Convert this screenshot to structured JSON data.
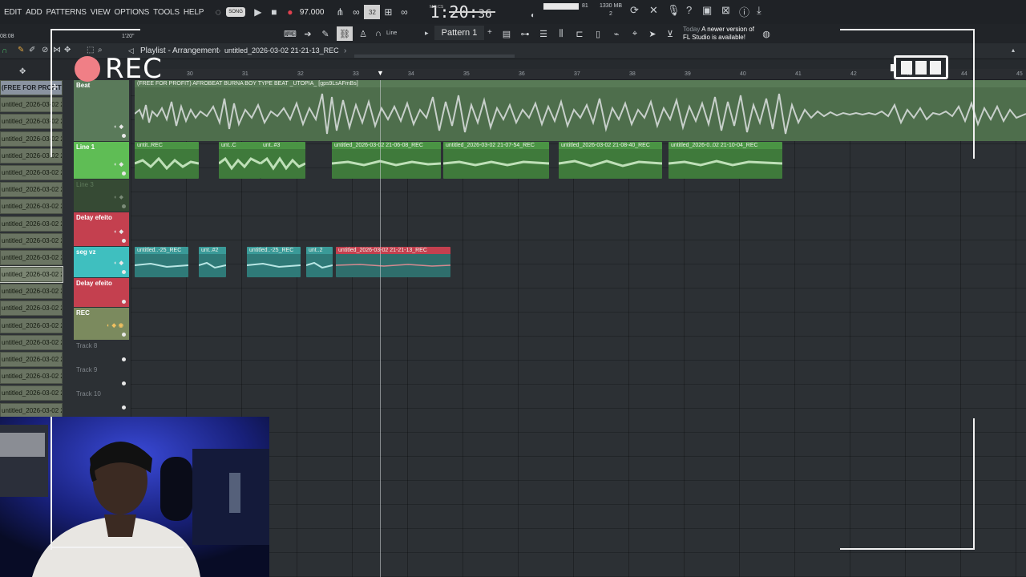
{
  "menu": {
    "edit": "EDIT",
    "add": "ADD",
    "patterns": "PATTERNS",
    "view": "VIEW",
    "options": "OPTIONS",
    "tools": "TOOLS",
    "help": "HELP"
  },
  "transport": {
    "song_mode": "SONG",
    "tempo": "97.000",
    "time_main": "1:20:",
    "time_sub": "36",
    "time_unit": "M:S:CS",
    "cpu_value": "81",
    "memory": "1330 MB",
    "voices": "2",
    "pattern_label": "Pattern 1",
    "snap_label": "Line",
    "hint_time": "08:08",
    "hint_pos": "1'20\""
  },
  "notice": {
    "line1_prefix": "Today",
    "line1": "A newer version of",
    "line2": "FL Studio is available!"
  },
  "playlist": {
    "title": "Playlist - Arrangement",
    "project": "untitled_2026-03-02 21-21-13_REC",
    "bar_numbers": [
      "30",
      "31",
      "32",
      "33",
      "34",
      "35",
      "36",
      "37",
      "38",
      "39",
      "40",
      "41",
      "42",
      "43",
      "44",
      "45"
    ]
  },
  "browser": {
    "items": [
      "(FREE FOR PROFIT) A...",
      "untitled_2026-03-02 20-",
      "untitled_2026-03-02 20-",
      "untitled_2026-03-02 20-",
      "untitled_2026-03-02 20-",
      "untitled_2026-03-02 20-",
      "untitled_2026-03-02 20-",
      "untitled_2026-03-02 20-",
      "untitled_2026-03-02 20-",
      "untitled_2026-03-02 20-",
      "untitled_2026-03-02 20-",
      "untitled_2026-03-02 20-",
      "untitled_2026-03-02 20-",
      "untitled_2026-03-02 20-",
      "untitled_2026-03-02 20-",
      "untitled_2026-03-02 20-",
      "untitled_2026-03-02 20-",
      "untitled_2026-03-02 20-",
      "untitled_2026-03-02 20-",
      "untitled_2026-03-02 20-"
    ]
  },
  "tracks": [
    {
      "name": "Beat",
      "color": "#5a7a5a"
    },
    {
      "name": "Line 1",
      "color": "#5fbd55"
    },
    {
      "name": "Line 3",
      "color": "#364a34"
    },
    {
      "name": "Delay efeito",
      "color": "#c4404f"
    },
    {
      "name": "seg vz",
      "color": "#3fbfbf"
    },
    {
      "name": "Delay efeito",
      "color": "#c4404f"
    },
    {
      "name": "REC",
      "color": "#7b8a5e"
    },
    {
      "name": "Track 8",
      "color": ""
    },
    {
      "name": "Track 9",
      "color": ""
    },
    {
      "name": "Track 10",
      "color": ""
    }
  ],
  "clips": {
    "beat": "(FREE FOR PROFIT) AFROBEAT BURNA BOY TYPE BEAT _UTOPIA_ [gps9LsAFmBs]",
    "line1": [
      "untit..REC",
      "unt..C",
      "unt..#3",
      "untitled_2026-03-02 21-06-08_REC",
      "untitled_2026-03-02 21-07-54_REC",
      "untitled_2026-03-02 21-08-40_REC",
      "untitled_2026-0..02 21-10-04_REC"
    ],
    "segvz": [
      "untitled..-25_REC",
      "unt..#2",
      "untitled..-25_REC",
      "unt..2",
      "untitled_2026-03-02 21-21-13_REC"
    ]
  },
  "overlay": {
    "rec_label": "REC"
  },
  "colors": {
    "accent_green": "#5fbd55",
    "accent_red": "#c4404f",
    "accent_cyan": "#3fbfbf",
    "record": "#f07f86"
  }
}
